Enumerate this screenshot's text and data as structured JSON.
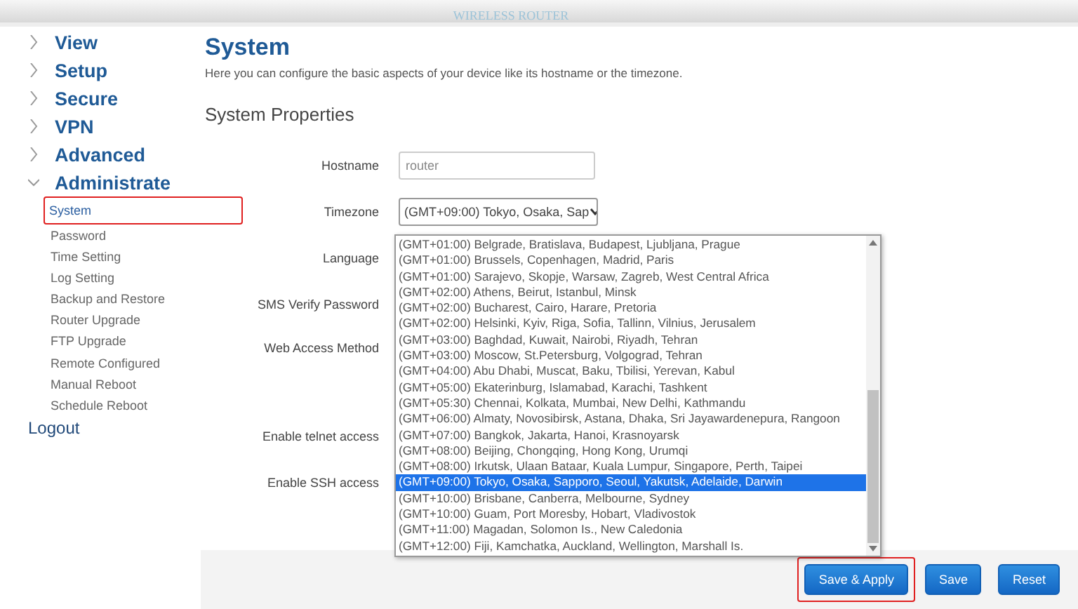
{
  "header": {
    "subtitle": "WIRELESS ROUTER"
  },
  "sidebar": {
    "sections": [
      {
        "label": "View",
        "expanded": false
      },
      {
        "label": "Setup",
        "expanded": false
      },
      {
        "label": "Secure",
        "expanded": false
      },
      {
        "label": "VPN",
        "expanded": false
      },
      {
        "label": "Advanced",
        "expanded": false
      },
      {
        "label": "Administrate",
        "expanded": true,
        "children": [
          {
            "label": "System",
            "selected": true,
            "highlighted": true
          },
          {
            "label": "Password",
            "selected": false,
            "highlighted": false
          },
          {
            "label": "Time Setting",
            "selected": false,
            "highlighted": false
          },
          {
            "label": "Log Setting",
            "selected": false,
            "highlighted": false
          },
          {
            "label": "Backup and Restore",
            "selected": false,
            "highlighted": false
          },
          {
            "label": "Router Upgrade",
            "selected": false,
            "highlighted": false
          },
          {
            "label": "FTP Upgrade",
            "selected": false,
            "highlighted": false
          },
          {
            "label": "Remote Configured",
            "selected": false,
            "highlighted": false
          },
          {
            "label": "Manual Reboot",
            "selected": false,
            "highlighted": false
          },
          {
            "label": "Schedule Reboot",
            "selected": false,
            "highlighted": false
          }
        ]
      }
    ],
    "logout": "Logout"
  },
  "page": {
    "title": "System",
    "description": "Here you can configure the basic aspects of your device like its hostname or the timezone.",
    "section_title": "System Properties"
  },
  "form": [
    {
      "label": "Hostname",
      "kind": "text",
      "value": "router"
    },
    {
      "label": "Timezone",
      "kind": "select",
      "value": "(GMT+09:00) Tokyo, Osaka, Sap"
    },
    {
      "label": "Language",
      "kind": "covered"
    },
    {
      "label": "SMS Verify Password",
      "kind": "covered"
    },
    {
      "label": "Web Access Method",
      "kind": "covered-tall"
    },
    {
      "label": "Enable telnet access",
      "kind": "covered"
    },
    {
      "label": "Enable SSH access",
      "kind": "covered"
    }
  ],
  "timezone_list": [
    {
      "label": "(GMT+01:00) Belgrade, Bratislava, Budapest, Ljubljana, Prague",
      "selected": false
    },
    {
      "label": "(GMT+01:00) Brussels, Copenhagen, Madrid, Paris",
      "selected": false
    },
    {
      "label": "(GMT+01:00) Sarajevo, Skopje, Warsaw, Zagreb, West Central Africa",
      "selected": false
    },
    {
      "label": "(GMT+02:00) Athens, Beirut, Istanbul, Minsk",
      "selected": false
    },
    {
      "label": "(GMT+02:00) Bucharest, Cairo, Harare, Pretoria",
      "selected": false
    },
    {
      "label": "(GMT+02:00) Helsinki, Kyiv, Riga, Sofia, Tallinn, Vilnius, Jerusalem",
      "selected": false
    },
    {
      "label": "(GMT+03:00) Baghdad, Kuwait, Nairobi, Riyadh, Tehran",
      "selected": false
    },
    {
      "label": "(GMT+03:00) Moscow, St.Petersburg, Volgograd, Tehran",
      "selected": false
    },
    {
      "label": "(GMT+04:00) Abu Dhabi, Muscat, Baku, Tbilisi, Yerevan, Kabul",
      "selected": false
    },
    {
      "label": "(GMT+05:00) Ekaterinburg, Islamabad, Karachi, Tashkent",
      "selected": false
    },
    {
      "label": "(GMT+05:30) Chennai, Kolkata, Mumbai, New Delhi, Kathmandu",
      "selected": false
    },
    {
      "label": "(GMT+06:00) Almaty, Novosibirsk, Astana, Dhaka, Sri Jayawardenepura, Rangoon",
      "selected": false
    },
    {
      "label": "(GMT+07:00) Bangkok, Jakarta, Hanoi, Krasnoyarsk",
      "selected": false
    },
    {
      "label": "(GMT+08:00) Beijing, Chongqing, Hong Kong, Urumqi",
      "selected": false
    },
    {
      "label": "(GMT+08:00) Irkutsk, Ulaan Bataar, Kuala Lumpur, Singapore, Perth, Taipei",
      "selected": false
    },
    {
      "label": "(GMT+09:00) Tokyo, Osaka, Sapporo, Seoul, Yakutsk, Adelaide, Darwin",
      "selected": true
    },
    {
      "label": "(GMT+10:00) Brisbane, Canberra, Melbourne, Sydney",
      "selected": false
    },
    {
      "label": "(GMT+10:00) Guam, Port Moresby, Hobart, Vladivostok",
      "selected": false
    },
    {
      "label": "(GMT+11:00) Magadan, Solomon Is., New Caledonia",
      "selected": false
    },
    {
      "label": "(GMT+12:00) Fiji, Kamchatka, Auckland, Wellington, Marshall Is.",
      "selected": false
    }
  ],
  "buttons": [
    {
      "label": "Save & Apply",
      "highlighted": true
    },
    {
      "label": "Save",
      "highlighted": false
    },
    {
      "label": "Reset",
      "highlighted": false
    }
  ]
}
